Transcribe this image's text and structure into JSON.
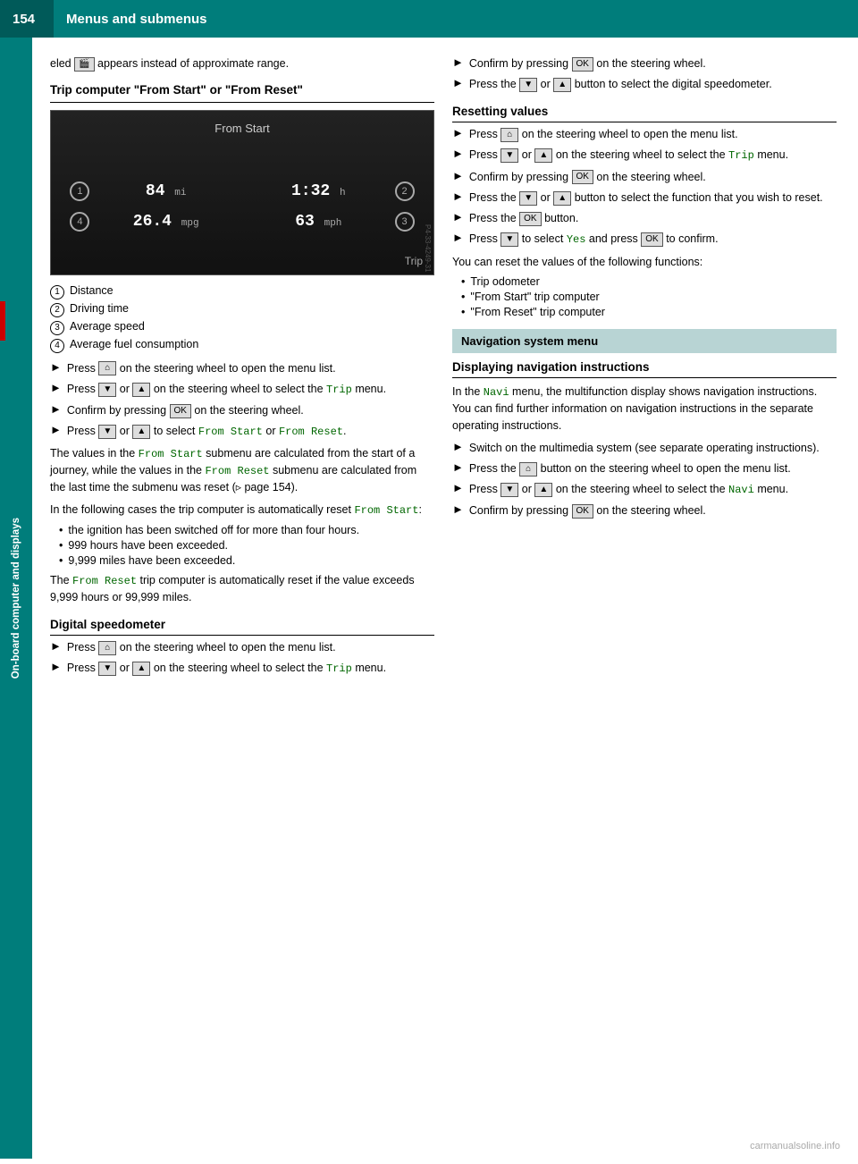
{
  "header": {
    "page_number": "154",
    "title": "Menus and submenus"
  },
  "sidebar": {
    "label": "On-board computer and displays"
  },
  "left_column": {
    "intro_text": "eled",
    "intro_text2": "appears instead of approximate range.",
    "section1": {
      "heading": "Trip computer \"From Start\" or \"From Reset\"",
      "image": {
        "title": "From Start",
        "row1_left_circle": "1",
        "row1_value": "84",
        "row1_unit": "mi",
        "row1_value2": "1:32",
        "row1_unit2": "h",
        "row1_right_circle": "2",
        "row2_left_circle": "4",
        "row2_value": "26.4",
        "row2_unit": "mpg",
        "row2_value2": "63",
        "row2_unit2": "mph",
        "row2_right_circle": "3",
        "bottom_label": "Trip",
        "tag": "P4-33-4249-31"
      },
      "legend": [
        {
          "num": "1",
          "text": "Distance"
        },
        {
          "num": "2",
          "text": "Driving time"
        },
        {
          "num": "3",
          "text": "Average speed"
        },
        {
          "num": "4",
          "text": "Average fuel consumption"
        }
      ],
      "steps": [
        {
          "text": "Press",
          "btn": "home",
          "text2": "on the steering wheel to open the menu list."
        },
        {
          "text": "Press",
          "btn": "down",
          "text_or": "or",
          "btn2": "up",
          "text2": "on the steering wheel to select the",
          "code": "Trip",
          "text3": "menu."
        },
        {
          "text": "Confirm by pressing",
          "btn": "OK",
          "text2": "on the steering wheel."
        },
        {
          "text": "Press",
          "btn": "down",
          "text_or": "or",
          "btn2": "up",
          "text2": "to select",
          "code1": "From Start",
          "text3": "or",
          "code2": "From Reset",
          "text4": "."
        }
      ]
    },
    "section1_body": [
      "The values in the <From Start> submenu are calculated from the start of a journey, while the values in the <From Reset> submenu are calculated from the last time the submenu was reset (▷ page 154).",
      "In the following cases the trip computer is automatically reset <From Start>:"
    ],
    "from_start_bullets": [
      "the ignition has been switched off for more than four hours.",
      "999 hours have been exceeded.",
      "9,999 miles have been exceeded."
    ],
    "from_reset_text": "The <From Reset> trip computer is automatically reset if the value exceeds 9,999 hours or 99,999 miles.",
    "section2": {
      "heading": "Digital speedometer",
      "steps": [
        {
          "text": "Press",
          "btn": "home",
          "text2": "on the steering wheel to open the menu list."
        },
        {
          "text": "Press",
          "btn": "down",
          "text_or": "or",
          "btn2": "up",
          "text2": "on the steering wheel to select the",
          "code": "Trip",
          "text3": "menu."
        }
      ]
    }
  },
  "right_column": {
    "digital_speedometer_cont": [
      {
        "text": "Confirm by pressing",
        "btn": "OK",
        "text2": "on the steering wheel."
      },
      {
        "text": "Press the",
        "btn": "down",
        "text_or": "or",
        "btn2": "up",
        "text2": "button to select the digital speedometer."
      }
    ],
    "section_resetting": {
      "heading": "Resetting values",
      "steps": [
        {
          "text": "Press",
          "btn": "home",
          "text2": "on the steering wheel to open the menu list."
        },
        {
          "text": "Press",
          "btn": "down",
          "text_or": "or",
          "btn2": "up",
          "text2": "on the steering wheel to select the",
          "code": "Trip",
          "text3": "menu."
        },
        {
          "text": "Confirm by pressing",
          "btn": "OK",
          "text2": "on the steering wheel."
        },
        {
          "text": "Press the",
          "btn": "down",
          "text_or": "or",
          "btn2": "up",
          "text2": "button to select the function that you wish to reset."
        },
        {
          "text": "Press the",
          "btn": "OK",
          "text2": "button."
        },
        {
          "text": "Press",
          "btn": "down",
          "text2": "to select",
          "code": "Yes",
          "text3": "and press",
          "btn2": "OK",
          "text4": "to confirm."
        }
      ],
      "can_reset_text": "You can reset the values of the following functions:",
      "reset_bullets": [
        "Trip odometer",
        "\"From Start\" trip computer",
        "\"From Reset\" trip computer"
      ]
    },
    "nav_menu_box": "Navigation system menu",
    "section_nav": {
      "heading": "Displaying navigation instructions",
      "body1": "In the",
      "code1": "Navi",
      "body2": "menu, the multifunction display shows navigation instructions. You can find further information on navigation instructions in the separate operating instructions.",
      "steps": [
        {
          "text": "Switch on the multimedia system (see separate operating instructions)."
        },
        {
          "text": "Press the",
          "btn": "home",
          "text2": "button on the steering wheel to open the menu list."
        },
        {
          "text": "Press",
          "btn": "down",
          "text_or": "or",
          "btn2": "up",
          "text2": "on the steering wheel to select the",
          "code": "Navi",
          "text3": "menu."
        },
        {
          "text": "Confirm by pressing",
          "btn": "OK",
          "text2": "on the steering wheel."
        }
      ]
    },
    "watermark": "carmanualsoline.info"
  }
}
